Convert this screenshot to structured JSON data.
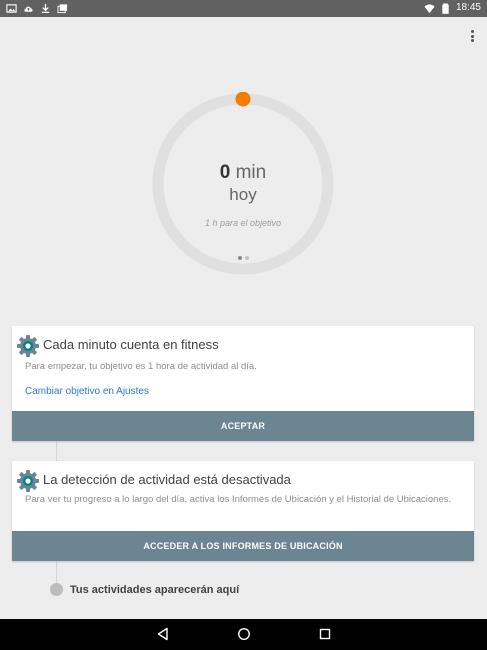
{
  "status_bar": {
    "time": "18:45",
    "left_icons": [
      "image-icon",
      "cloud-upload-icon",
      "download-icon",
      "photos-icon"
    ],
    "right_icons": [
      "wifi-icon",
      "battery-icon"
    ]
  },
  "ring": {
    "value": "0",
    "unit": "min",
    "period": "hoy",
    "goal_text": "1 h para el objetivo",
    "progress": 0,
    "accent_color": "#f57c00",
    "track_color": "#e0e0e0",
    "page_count": 2,
    "active_page": 0
  },
  "card_goal": {
    "icon": "gear-icon",
    "title": "Cada minuto cuenta en fitness",
    "body": "Para empezar, tu objetivo es 1 hora de actividad al día.",
    "link": "Cambiar objetivo en Ajustes",
    "button": "ACEPTAR"
  },
  "card_location": {
    "icon": "gear-icon",
    "title": "La detección de actividad está desactivada",
    "body": "Para ver tu progreso a lo largo del día, activa los Informes de Ubicación y el Historial de Ubicaciones.",
    "button": "ACCEDER A LOS INFORMES DE UBICACIÓN"
  },
  "activities": {
    "label": "Tus actividades aparecerán aquí"
  },
  "colors": {
    "button": "#6b8593",
    "link": "#2979d6",
    "gear": "#00838f"
  }
}
